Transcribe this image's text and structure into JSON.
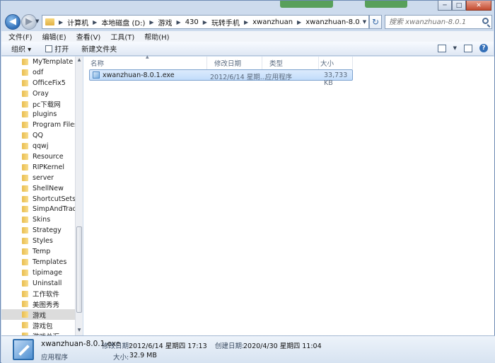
{
  "window": {
    "minimize": "─",
    "maximize": "□",
    "close": "✕"
  },
  "address": {
    "crumbs": [
      "计算机",
      "本地磁盘 (D:)",
      "游戏",
      "430",
      "玩转手机",
      "xwanzhuan",
      "xwanzhuan-8.0.1"
    ]
  },
  "search": {
    "placeholder": "搜索 xwanzhuan-8.0.1"
  },
  "menu": {
    "items": [
      "文件(F)",
      "编辑(E)",
      "查看(V)",
      "工具(T)",
      "帮助(H)"
    ]
  },
  "toolbar": {
    "organize": "组织 ▾",
    "open": "打开",
    "new_folder": "新建文件夹",
    "help": "?"
  },
  "nav": {
    "items": [
      "MyTemplate",
      "odf",
      "OfficeFix5",
      "Oray",
      "pc下载网",
      "plugins",
      "Program Files",
      "QQ",
      "qqwj",
      "Resource",
      "RIPKernel",
      "server",
      "ShellNew",
      "ShortcutSets",
      "SimpAndTradCo",
      "Skins",
      "Strategy",
      "Styles",
      "Temp",
      "Templates",
      "tipimage",
      "Uninstall",
      "工作软件",
      "美图秀秀",
      "游戏",
      "游戏包",
      "游戏总汇"
    ],
    "selected_index": 24
  },
  "columns": {
    "name": "名称",
    "date": "修改日期",
    "type": "类型",
    "size": "大小"
  },
  "files": [
    {
      "name": "xwanzhuan-8.0.1.exe",
      "date": "2012/6/14 星期...",
      "type": "应用程序",
      "size": "33,733 KB"
    }
  ],
  "details": {
    "name": "xwanzhuan-8.0.1.exe",
    "modified_label": "修改日期:",
    "modified_value": "2012/6/14 星期四 17:13",
    "created_label": "创建日期:",
    "created_value": "2020/4/30 星期四 11:04",
    "type": "应用程序",
    "size_label": "大小:",
    "size_value": "32.9 MB"
  }
}
